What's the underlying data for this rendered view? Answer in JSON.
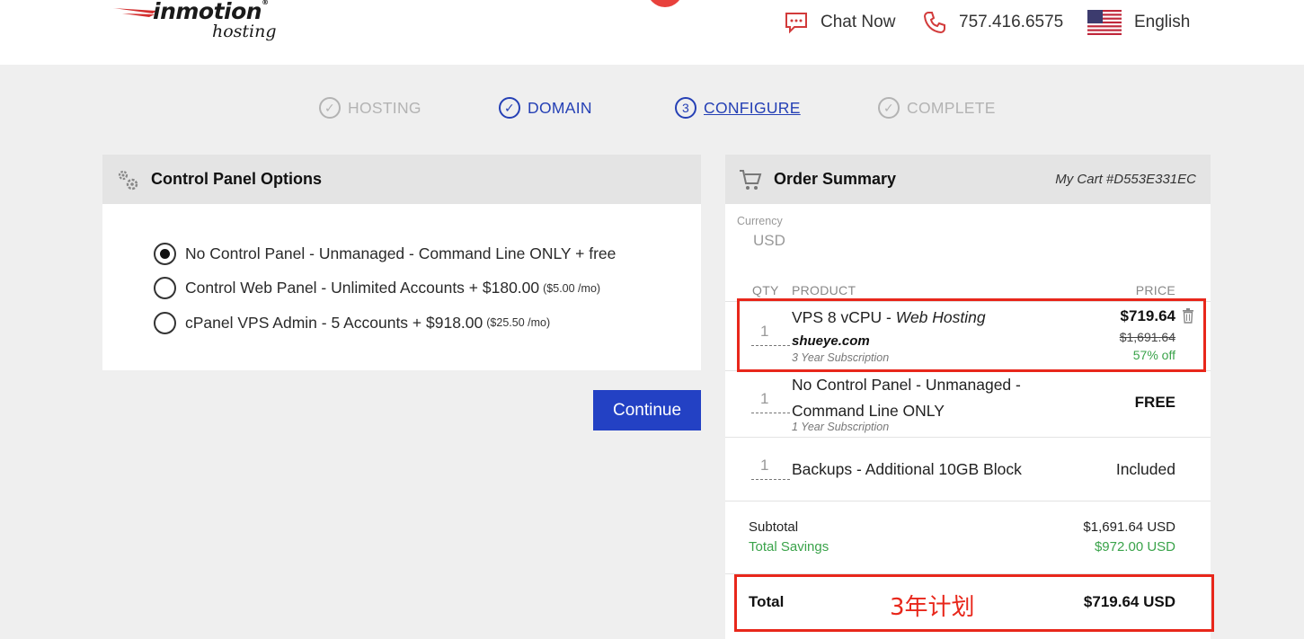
{
  "header": {
    "logo_main": "inmotion",
    "logo_reg": "®",
    "logo_sub": "hosting",
    "chat_label": "Chat Now",
    "phone": "757.416.6575",
    "language": "English"
  },
  "steps": [
    {
      "label": "HOSTING",
      "icon": "✓",
      "state": "done"
    },
    {
      "label": "DOMAIN",
      "icon": "✓",
      "state": "done"
    },
    {
      "label": "CONFIGURE",
      "icon": "3",
      "state": "current"
    },
    {
      "label": "COMPLETE",
      "icon": "✓",
      "state": "pending"
    }
  ],
  "control_panel": {
    "title": "Control Panel Options",
    "options": [
      {
        "label": "No Control Panel - Unmanaged - Command Line ONLY + free",
        "small": "",
        "selected": true
      },
      {
        "label": "Control Web Panel - Unlimited Accounts + $180.00",
        "small": "($5.00 /mo)",
        "selected": false
      },
      {
        "label": "cPanel VPS Admin - 5 Accounts + $918.00",
        "small": "($25.50 /mo)",
        "selected": false
      }
    ],
    "continue_label": "Continue"
  },
  "order_summary": {
    "title": "Order Summary",
    "cart_id": "My Cart #D553E331EC",
    "currency_label": "Currency",
    "currency_value": "USD",
    "columns": {
      "qty": "QTY",
      "product": "PRODUCT",
      "price": "PRICE"
    },
    "items": [
      {
        "qty": "1",
        "name": "VPS 8 vCPU",
        "name_sep": " - ",
        "name_italic": "Web Hosting",
        "domain": "shueye.com",
        "subscription": "3 Year Subscription",
        "price": "$719.64",
        "old_price": "$1,691.64",
        "discount": "57% off"
      },
      {
        "qty": "1",
        "name_line1": "No Control Panel - Unmanaged -",
        "name_line2": "Command Line ONLY",
        "subscription": "1 Year Subscription",
        "price": "FREE"
      },
      {
        "qty": "1",
        "name": "Backups - Additional 10GB Block",
        "price": "Included"
      }
    ],
    "subtotal_label": "Subtotal",
    "subtotal_value": "$1,691.64 USD",
    "savings_label": "Total Savings",
    "savings_value": "$972.00 USD",
    "total_label": "Total",
    "total_value": "$719.64 USD"
  },
  "annotation": "3年计划",
  "colors": {
    "accent": "#2341c4",
    "brand_red": "#e8413c",
    "savings_green": "#3aa34a",
    "highlight_red": "#e8271b"
  }
}
